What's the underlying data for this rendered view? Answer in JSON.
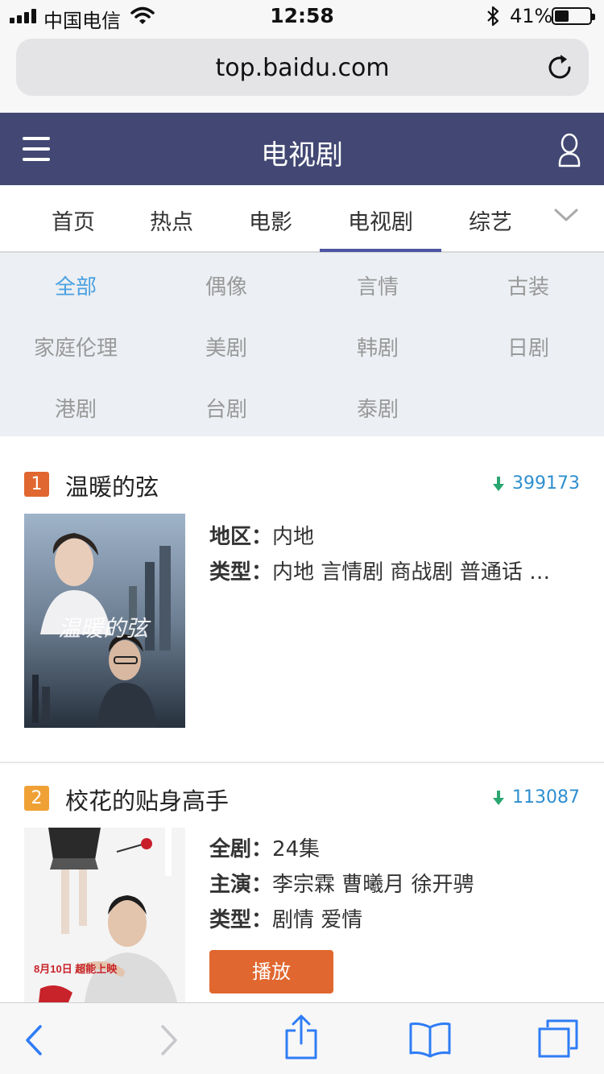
{
  "status": {
    "carrier": "中国电信",
    "time": "12:58",
    "battery_pct": "41%",
    "battery_level": 0.41
  },
  "browser": {
    "url": "top.baidu.com"
  },
  "header": {
    "title": "电视剧"
  },
  "nav": {
    "tabs": [
      "首页",
      "热点",
      "电影",
      "电视剧",
      "综艺"
    ],
    "active_index": 3
  },
  "categories": [
    "全部",
    "偶像",
    "言情",
    "古装",
    "家庭伦理",
    "美剧",
    "韩剧",
    "日剧",
    "港剧",
    "台剧",
    "泰剧"
  ],
  "category_active_index": 0,
  "items": [
    {
      "rank": "1",
      "title": "温暖的弦",
      "count": "399173",
      "poster_text": "温暖的弦",
      "rows": [
        {
          "label": "地区",
          "value": "内地"
        },
        {
          "label": "类型",
          "value": "内地 言情剧 商战剧 普通话 …"
        }
      ]
    },
    {
      "rank": "2",
      "title": "校花的贴身高手",
      "count": "113087",
      "poster_text": "8月10日 超能上映",
      "rows": [
        {
          "label": "全剧",
          "value": "24集"
        },
        {
          "label": "主演",
          "value": "李宗霖 曹曦月 徐开骋"
        },
        {
          "label": "类型",
          "value": "剧情 爱情"
        }
      ],
      "play_label": "播放"
    }
  ],
  "colors": {
    "header_bg": "#424873",
    "rank1": "#e0672f",
    "rank2": "#f0a135",
    "category_active": "#4aa1e2",
    "count": "#2e8fcf",
    "play_button": "#e0672f",
    "safari_blue": "#2f7cf6"
  },
  "icons": [
    "signal-icon",
    "wifi-icon",
    "bluetooth-icon",
    "battery-icon",
    "reload-icon",
    "menu-icon",
    "user-icon",
    "chevron-down-icon",
    "download-arrow-icon",
    "back-icon",
    "forward-icon",
    "share-icon",
    "bookmarks-icon",
    "tabs-icon"
  ]
}
